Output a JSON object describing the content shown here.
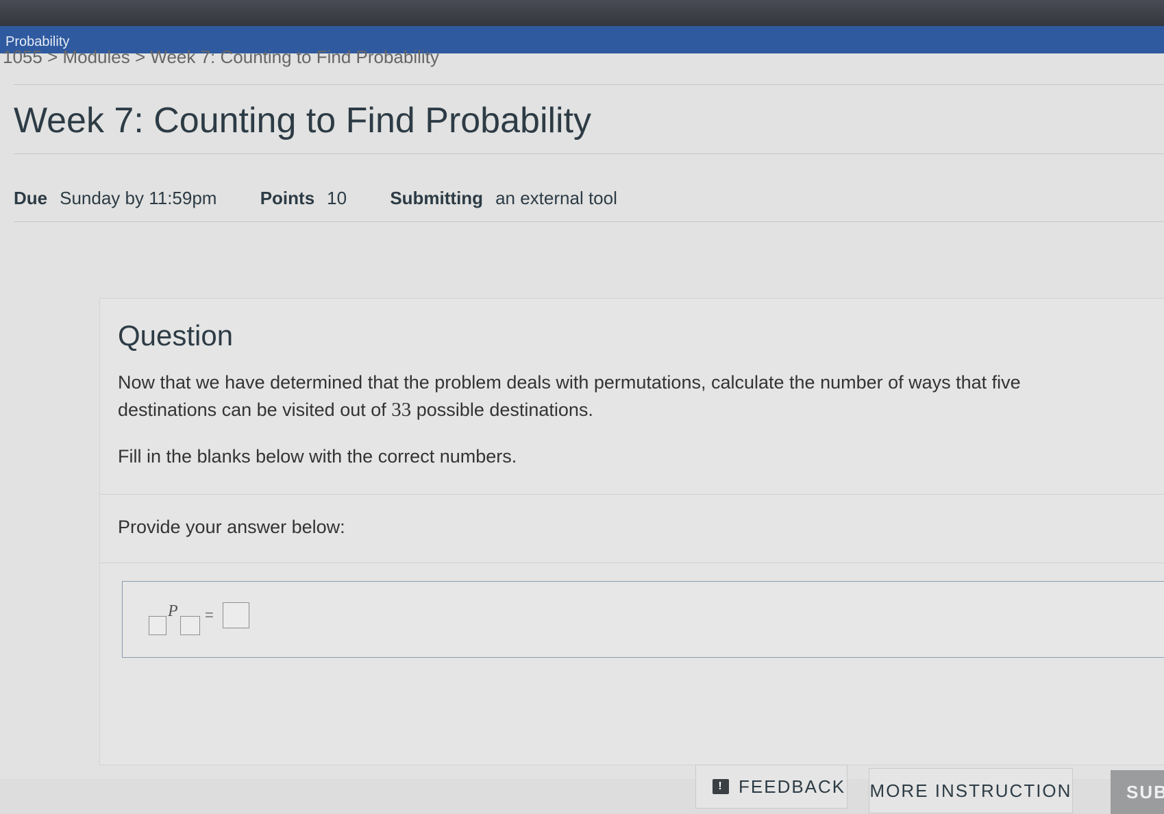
{
  "browser": {
    "tab_title": "Probability"
  },
  "breadcrumb": {
    "text": "1055 > Modules > Week 7: Counting to Find Probability"
  },
  "page": {
    "title": "Week 7: Counting to Find Probability"
  },
  "meta": {
    "due_label": "Due",
    "due_value": "Sunday by 11:59pm",
    "points_label": "Points",
    "points_value": "10",
    "submitting_label": "Submitting",
    "submitting_value": "an external tool"
  },
  "question": {
    "heading": "Question",
    "text_before": "Now that we have determined that the problem deals with permutations, calculate the number of ways that five destinations can be visited out of ",
    "number": "33",
    "text_after": " possible destinations.",
    "instruction": "Fill in the blanks below with the correct numbers.",
    "prompt": "Provide your answer below:"
  },
  "answer": {
    "operator": "P",
    "equals": "="
  },
  "buttons": {
    "feedback": "FEEDBACK",
    "more_instruction": "MORE INSTRUCTION",
    "submit": "SUB"
  },
  "icons": {
    "feedback": "feedback-icon"
  }
}
